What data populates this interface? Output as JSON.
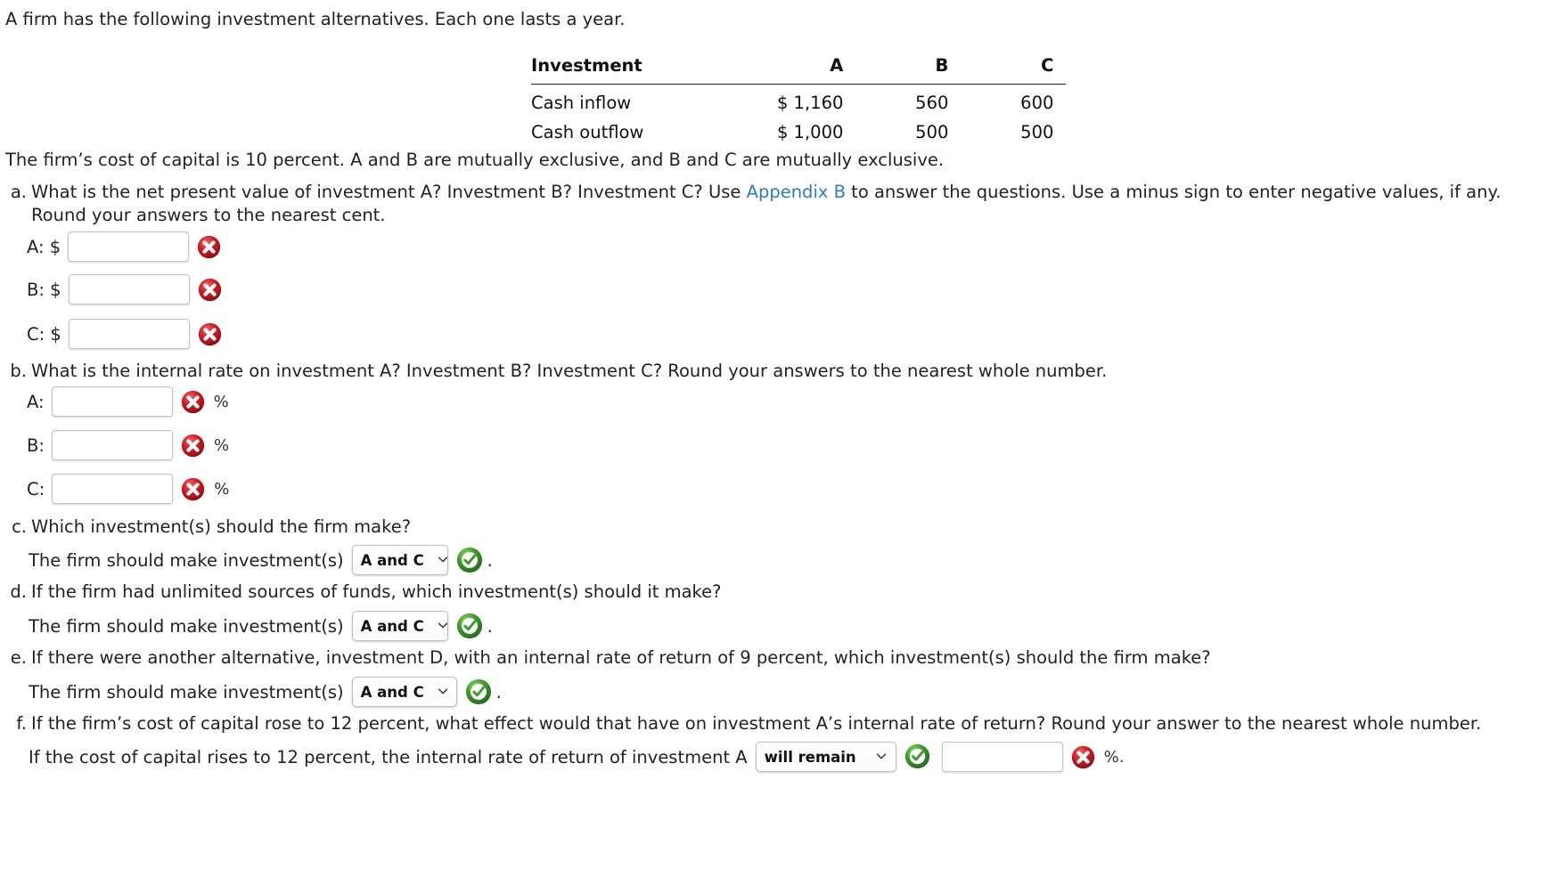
{
  "intro": "A firm has the following investment alternatives. Each one lasts a year.",
  "table": {
    "header": {
      "label": "Investment",
      "a": "A",
      "b": "B",
      "c": "C"
    },
    "rows": [
      {
        "label": "Cash inflow",
        "a": "$ 1,160",
        "b": "560",
        "c": "600"
      },
      {
        "label": "Cash outflow",
        "a": "$ 1,000",
        "b": "500",
        "c": "500"
      }
    ]
  },
  "cost_of_capital_line": "The firm’s cost of capital is 10 percent. A and B are mutually exclusive, and B and C are mutually exclusive.",
  "questions": {
    "a": {
      "marker": "a.",
      "text_before_link": "What is the net present value of investment A? Investment B? Investment C? Use ",
      "link": "Appendix B",
      "text_after_link": " to answer the questions. Use a minus sign to enter negative values, if any. Round your answers to the nearest cent.",
      "answers": [
        {
          "label": "A: $",
          "value": "",
          "status": "incorrect"
        },
        {
          "label": "B: $",
          "value": "",
          "status": "incorrect"
        },
        {
          "label": "C: $",
          "value": "",
          "status": "incorrect"
        }
      ]
    },
    "b": {
      "marker": "b.",
      "text": "What is the internal rate on investment A? Investment B? Investment C? Round your answers to the nearest whole number.",
      "answers": [
        {
          "label": "A:",
          "value": "",
          "status": "incorrect",
          "unit": "%"
        },
        {
          "label": "B:",
          "value": "",
          "status": "incorrect",
          "unit": "%"
        },
        {
          "label": "C:",
          "value": "",
          "status": "incorrect",
          "unit": "%"
        }
      ]
    },
    "c": {
      "marker": "c.",
      "text": "Which investment(s) should the firm make?",
      "answer_prefix": "The firm should make investment(s)",
      "select_value": "A and C",
      "status": "correct",
      "period": "."
    },
    "d": {
      "marker": "d.",
      "text": "If the firm had unlimited sources of funds, which investment(s) should it make?",
      "answer_prefix": "The firm should make investment(s)",
      "select_value": "A and C",
      "status": "correct",
      "period": "."
    },
    "e": {
      "marker": "e.",
      "text": "If there were another alternative, investment D, with an internal rate of return of 9 percent, which investment(s) should the firm make?",
      "answer_prefix": "The firm should make investment(s)",
      "select_value": "A and C",
      "status": "correct",
      "period": "."
    },
    "f": {
      "marker": "f.",
      "text": "If the firm’s cost of capital rose to 12 percent, what effect would that have on investment A’s internal rate of return? Round your answer to the nearest whole number.",
      "answer_prefix": "If the cost of capital rises to 12 percent, the internal rate of return of investment A",
      "select_value": "will remain",
      "select_status": "correct",
      "input_value": "",
      "input_status": "incorrect",
      "unit": "%."
    }
  },
  "colors": {
    "link": "#2e7bc4",
    "incorrect": "#c1121c",
    "correct": "#3f9c2c",
    "text": "#222222",
    "input_border": "#c3c3c3"
  },
  "icons": {
    "incorrect": "error-x-icon",
    "correct": "success-check-icon",
    "chevron": "chevron-down-icon"
  }
}
